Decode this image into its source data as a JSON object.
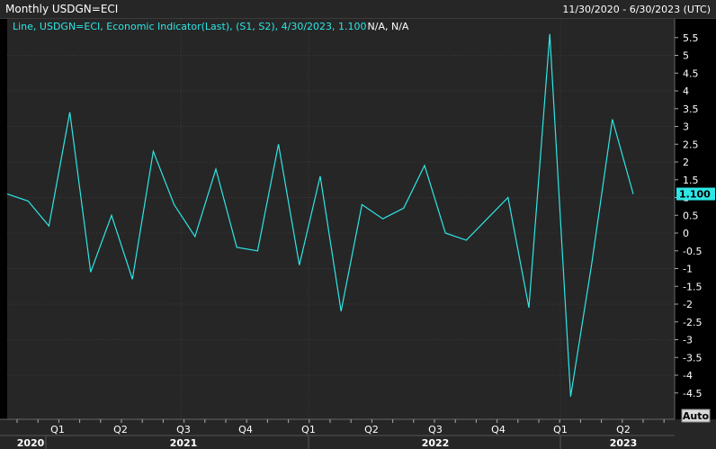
{
  "header": {
    "title": "Monthly USDGN=ECI",
    "date_range": "11/30/2020 - 6/30/2023 (UTC)"
  },
  "legend": {
    "text": "Line, USDGN=ECI, Economic Indicator(Last), (S1, S2), 4/30/2023, 1.100",
    "na_text": "N/A, N/A"
  },
  "last_value_label": "1.100",
  "auto_button_label": "Auto",
  "colors": {
    "background": "#000000",
    "plot_background": "#262626",
    "line": "#2ee6e6",
    "text": "#ffffff",
    "grid": "#3b3b3b",
    "last_value_bg": "#2ee6e6"
  },
  "chart_data": {
    "type": "line",
    "series": [
      {
        "values": [
          1.1,
          0.9,
          0.2,
          3.4,
          -1.1,
          0.5,
          -1.3,
          2.3,
          0.8,
          -0.1,
          1.8,
          -0.4,
          -0.5,
          2.5,
          -0.9,
          1.6,
          -2.2,
          0.8,
          0.4,
          0.7,
          1.9,
          0.0,
          -0.2,
          0.4,
          1.0,
          -2.1,
          5.6,
          -4.6,
          -0.9,
          3.2,
          1.1
        ]
      }
    ],
    "ylim": [
      -5,
      6
    ],
    "y_ticks": [
      "5.5",
      "5",
      "4.5",
      "4",
      "3.5",
      "3",
      "2.5",
      "2",
      "1.5",
      "1",
      "0.5",
      "0",
      "-0.5",
      "-1",
      "-1.5",
      "-2",
      "-2.5",
      "-3",
      "-3.5",
      "-4",
      "-4.5"
    ],
    "x_quarter_labels": [
      "Q1",
      "Q2",
      "Q3",
      "Q4",
      "Q1",
      "Q2",
      "Q3",
      "Q4",
      "Q1",
      "Q2"
    ],
    "x_year_labels": [
      "2020",
      "2021",
      "2022",
      "2023"
    ],
    "grid": true
  }
}
